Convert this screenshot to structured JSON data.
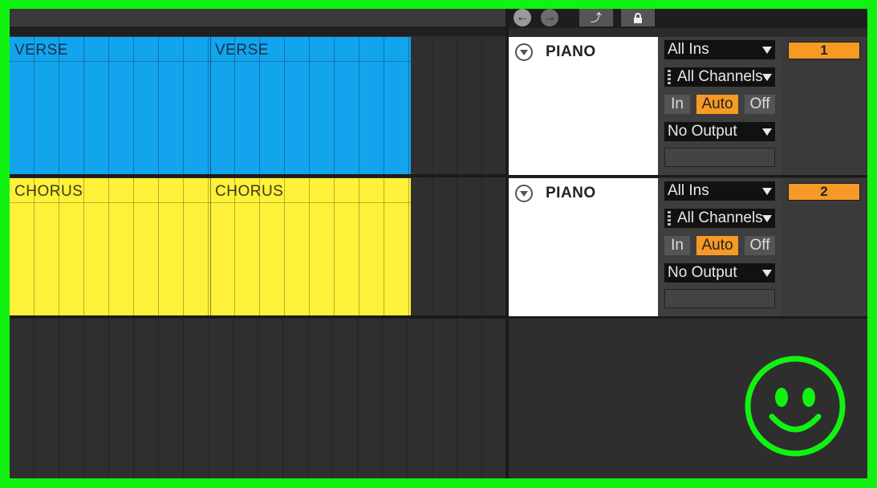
{
  "toolbar": {
    "back_icon": "arrow-left-icon",
    "forward_icon": "arrow-right-icon",
    "draw_icon": "pencil-icon",
    "lock_icon": "lock-icon"
  },
  "clips": [
    {
      "track": 1,
      "label": "VERSE",
      "color": "#13a4ee"
    },
    {
      "track": 1,
      "label": "VERSE",
      "color": "#13a4ee"
    },
    {
      "track": 2,
      "label": "CHORUS",
      "color": "#fff13a"
    },
    {
      "track": 2,
      "label": "CHORUS",
      "color": "#fff13a"
    }
  ],
  "tracks": [
    {
      "name": "PIANO",
      "input_type": "All Ins",
      "input_channel": "All Channels",
      "monitor": {
        "in": "In",
        "auto": "Auto",
        "off": "Off",
        "active": "Auto"
      },
      "output": "No Output",
      "number": "1"
    },
    {
      "name": "PIANO",
      "input_type": "All Ins",
      "input_channel": "All Channels",
      "monitor": {
        "in": "In",
        "auto": "Auto",
        "off": "Off",
        "active": "Auto"
      },
      "output": "No Output",
      "number": "2"
    }
  ],
  "colors": {
    "frame": "#12f212",
    "verse": "#13a4ee",
    "chorus": "#fff13a",
    "accent": "#f69a25"
  },
  "overlay_icon": "smiley-face-icon"
}
